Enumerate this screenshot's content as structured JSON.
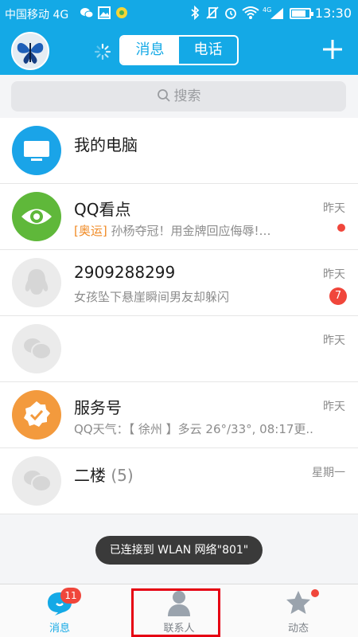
{
  "status_bar": {
    "carrier": "中国移动 4G",
    "network_label": "4G",
    "battery_percent": 80,
    "time": "13:30"
  },
  "header": {
    "tabs": [
      {
        "label": "消息",
        "active": true
      },
      {
        "label": "电话",
        "active": false
      }
    ],
    "accent_color": "#14a9e6"
  },
  "search": {
    "placeholder": "搜索"
  },
  "conversations": [
    {
      "name": "我的电脑",
      "preview": "",
      "time": "",
      "icon": "monitor-icon",
      "avatar_color": "#1aa4e8"
    },
    {
      "name": "QQ看点",
      "tag": "[奥运]",
      "preview": "孙杨夺冠！用金牌回应侮辱!…",
      "time": "昨天",
      "icon": "eye-icon",
      "avatar_color": "#5fb83a",
      "unread_dot": true
    },
    {
      "name": "2909288299",
      "preview": "女孩坠下悬崖瞬间男友却躲闪",
      "time": "昨天",
      "icon": "penguin-icon",
      "avatar_color": "#ebebeb",
      "unread_count": "7"
    },
    {
      "name": "",
      "preview": "",
      "time": "昨天",
      "icon": "chat-bubbles-icon",
      "avatar_color": "#ebebeb"
    },
    {
      "name": "服务号",
      "preview": "QQ天气：【 徐州 】多云 26°/33°, 08:17更...",
      "time": "昨天",
      "icon": "verified-badge-icon",
      "avatar_color": "#f39a3d"
    },
    {
      "name": "二楼",
      "count": "(5)",
      "preview": "",
      "time": "星期一",
      "icon": "chat-bubbles-icon",
      "avatar_color": "#ebebeb"
    }
  ],
  "toast": {
    "text": "已连接到 WLAN 网络\"801\""
  },
  "bottom_nav": [
    {
      "label": "消息",
      "badge": "11",
      "active": true
    },
    {
      "label": "联系人",
      "active": false
    },
    {
      "label": "动态",
      "dot": true,
      "active": false
    }
  ]
}
